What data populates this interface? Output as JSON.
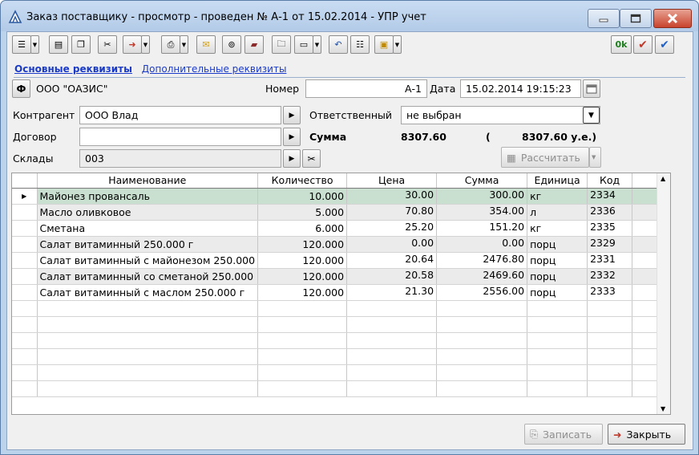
{
  "window": {
    "title": "Заказ поставщику - просмотр - проведен № А-1 от 15.02.2014 - УПР учет",
    "minimize_icon": "minimize-icon",
    "maximize_icon": "maximize-icon",
    "close_icon": "close-icon"
  },
  "toolbar": {
    "ok_label": "0k",
    "icons": [
      "list-menu-icon",
      "form-icon",
      "copy-icon",
      "delete-icon",
      "document-arrow-icon",
      "print-icon",
      "envelope-image-icon",
      "scan-icon",
      "book-icon",
      "folder-icon",
      "card-icon",
      "undo-icon",
      "structure-icon",
      "briefcase-icon",
      "ok-icon",
      "check-red-icon",
      "check-blue-icon"
    ]
  },
  "tabs": {
    "main": "Основные реквизиты",
    "additional": "Дополнительные реквизиты"
  },
  "header": {
    "firm_button": "Ф",
    "firm_name": "ООО \"ОАЗИС\"",
    "number_label": "Номер",
    "number_value": "А-1",
    "date_label": "Дата",
    "date_value": "15.02.2014 19:15:23"
  },
  "form": {
    "contractor_label": "Контрагент",
    "contractor_value": "ООО Влад",
    "responsible_label": "Ответственный",
    "responsible_value": "не выбран",
    "contract_label": "Договор",
    "contract_value": "",
    "sum_label": "Сумма",
    "sum_value": "8307.60",
    "sum_open_paren": "(",
    "sum_ue": "8307.60 у.е.)",
    "warehouse_label": "Склады",
    "warehouse_value": "003",
    "calculate_label": "Рассчитать"
  },
  "grid": {
    "columns": [
      "Наименование",
      "Количество",
      "Цена",
      "Сумма",
      "Единица",
      "Код"
    ],
    "rows": [
      {
        "name": "Майонез провансаль",
        "qty": "10.000",
        "price": "30.00",
        "sum": "300.00",
        "unit": "кг",
        "code": "2334"
      },
      {
        "name": "Масло оливковое",
        "qty": "5.000",
        "price": "70.80",
        "sum": "354.00",
        "unit": "л",
        "code": "2336"
      },
      {
        "name": "Сметана",
        "qty": "6.000",
        "price": "25.20",
        "sum": "151.20",
        "unit": "кг",
        "code": "2335"
      },
      {
        "name": "Салат витаминный 250.000 г",
        "qty": "120.000",
        "price": "0.00",
        "sum": "0.00",
        "unit": "порц",
        "code": "2329"
      },
      {
        "name": "Салат витаминный с майонезом 250.000",
        "qty": "120.000",
        "price": "20.64",
        "sum": "2476.80",
        "unit": "порц",
        "code": "2331"
      },
      {
        "name": "Салат витаминный со сметаной 250.000",
        "qty": "120.000",
        "price": "20.58",
        "sum": "2469.60",
        "unit": "порц",
        "code": "2332"
      },
      {
        "name": "Салат витаминный с маслом 250.000 г",
        "qty": "120.000",
        "price": "21.30",
        "sum": "2556.00",
        "unit": "порц",
        "code": "2333"
      }
    ]
  },
  "footer": {
    "save_label": "Записать",
    "close_label": "Закрыть"
  },
  "colors": {
    "selected_row": "#c9e0d0",
    "alt_row": "#ebebeb",
    "link": "#1a3bc9"
  }
}
